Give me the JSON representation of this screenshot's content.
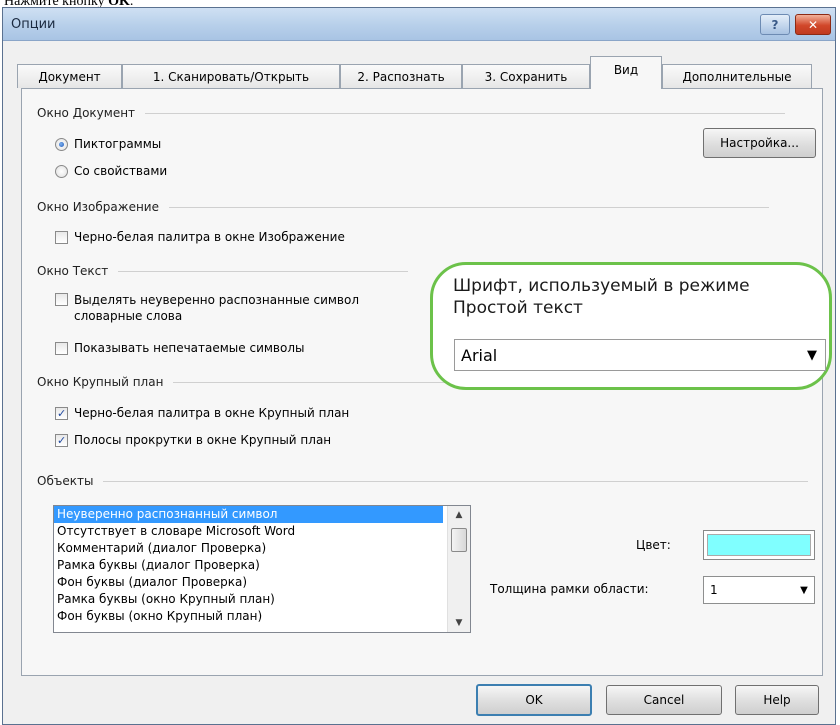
{
  "caption": {
    "prefix": "Нажмите кнопку ",
    "bold": "OK",
    "suffix": "."
  },
  "window": {
    "title": "Опции",
    "help_glyph": "?",
    "close_glyph": "✕"
  },
  "tabs": [
    {
      "label": "Документ"
    },
    {
      "label": "1. Сканировать/Открыть"
    },
    {
      "label": "2. Распознать"
    },
    {
      "label": "3. Сохранить"
    },
    {
      "label": "Вид",
      "active": true
    },
    {
      "label": "Дополнительные"
    }
  ],
  "doc_window": {
    "section": "Окно Документ",
    "opt_icons": "Пиктограммы",
    "opt_props": "Со свойствами",
    "selected": "Пиктограммы",
    "settings_button": "Настройка..."
  },
  "image_window": {
    "section": "Окно Изображение",
    "bw_palette": {
      "label": "Черно-белая палитра в окне Изображение",
      "checked": false
    }
  },
  "text_window": {
    "section": "Окно Текст",
    "highlight": {
      "label_line1": "Выделять неуверенно распознанные символ",
      "label_line2": "словарные слова",
      "checked": false
    },
    "nonprint": {
      "label": "Показывать непечатаемые символы",
      "checked": false
    }
  },
  "zoom_window": {
    "section": "Окно Крупный план",
    "bw_palette": {
      "label": "Черно-белая палитра в окне Крупный план",
      "checked": true
    },
    "scrollbars": {
      "label": "Полосы прокрутки в окне Крупный план",
      "checked": true
    }
  },
  "objects": {
    "section": "Объекты",
    "items": [
      "Неуверенно распознанный символ",
      "Отсутствует в словаре Microsoft Word",
      "Комментарий (диалог Проверка)",
      "Рамка буквы (диалог Проверка)",
      "Фон буквы (диалог Проверка)",
      "Рамка буквы (окно Крупный план)",
      "Фон буквы (окно Крупный план)"
    ],
    "selected_index": 0,
    "color_label": "Цвет:",
    "color_value": "#80ffff",
    "border_label": "Толщина рамки области:",
    "border_value": "1"
  },
  "callout": {
    "title": "Шрифт, используемый в режиме\nПростой текст",
    "font_value": "Arial",
    "border_color": "#6cc24a"
  },
  "buttons": {
    "ok": "OK",
    "cancel": "Cancel",
    "help": "Help"
  },
  "icons": {
    "dropdown": "▼",
    "scroll_up": "▲",
    "scroll_down": "▼"
  }
}
